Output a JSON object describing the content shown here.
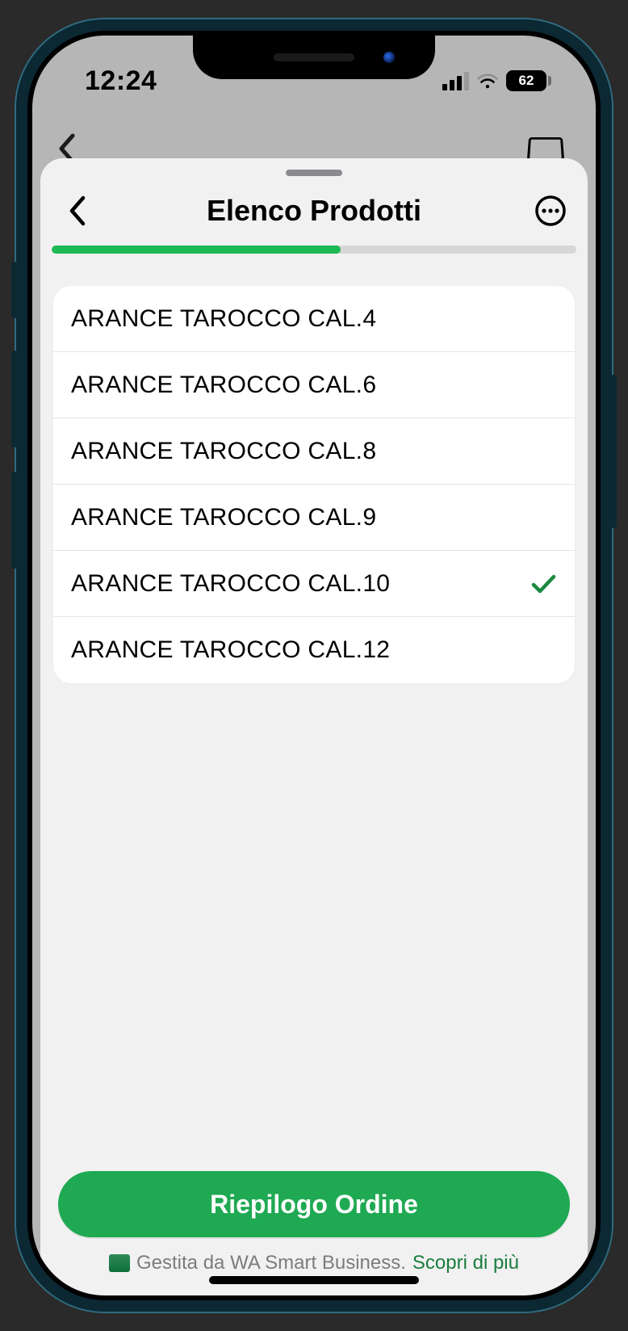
{
  "status": {
    "time": "12:24",
    "battery_pct": "62"
  },
  "sheet": {
    "title": "Elenco Prodotti",
    "progress_pct": 55
  },
  "products": [
    {
      "label": "ARANCE TAROCCO CAL.4",
      "selected": false
    },
    {
      "label": "ARANCE TAROCCO CAL.6",
      "selected": false
    },
    {
      "label": "ARANCE TAROCCO CAL.8",
      "selected": false
    },
    {
      "label": "ARANCE TAROCCO CAL.9",
      "selected": false
    },
    {
      "label": "ARANCE TAROCCO CAL.10",
      "selected": true
    },
    {
      "label": "ARANCE TAROCCO CAL.12",
      "selected": false
    }
  ],
  "footer": {
    "cta": "Riepilogo Ordine",
    "managed_text": "Gestita da WA Smart Business.",
    "learn_more": "Scopri di più"
  }
}
